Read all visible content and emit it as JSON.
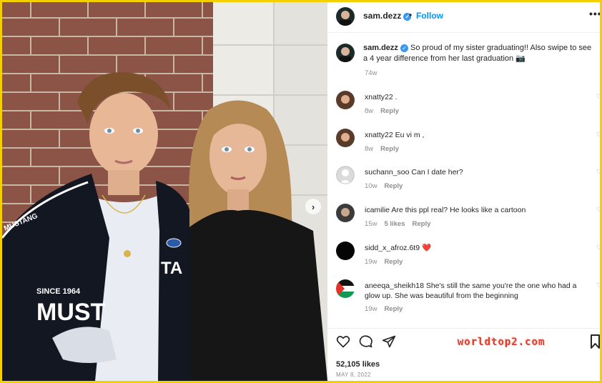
{
  "post": {
    "username": "sam.dezz",
    "dot": "•",
    "follow_label": "Follow",
    "more_label": "•••",
    "verified_glyph": "✓",
    "next_glyph": "›"
  },
  "caption": {
    "username": "sam.dezz",
    "text": "So proud of my sister graduating!! Also swipe to see a 4 year difference from her last graduation 📷",
    "time": "74w"
  },
  "comments": [
    {
      "username": "xnatty22",
      "text": ".",
      "time": "8w",
      "likes": "",
      "reply": "Reply"
    },
    {
      "username": "xnatty22",
      "text": "Eu vi m ,",
      "time": "8w",
      "likes": "",
      "reply": "Reply"
    },
    {
      "username": "suchann_soo",
      "text": "Can I date her?",
      "time": "10w",
      "likes": "",
      "reply": "Reply"
    },
    {
      "username": "icamilie",
      "text": "Are this ppl real? He looks like a cartoon",
      "time": "15w",
      "likes": "5 likes",
      "reply": "Reply"
    },
    {
      "username": "sidd_x_afroz.6t9",
      "text": "❤️",
      "time": "19w",
      "likes": "",
      "reply": "Reply"
    },
    {
      "username": "aneeqa_sheikh18",
      "text": "She's still the same you're the one who had a glow up. She was beautiful from the beginning",
      "time": "19w",
      "likes": "",
      "reply": "Reply"
    }
  ],
  "footer": {
    "likes": "52,105 likes",
    "date": "MAY 8, 2022",
    "watermark": "worldtop2.com"
  },
  "icons": [
    "heart-icon",
    "comment-icon",
    "share-icon",
    "bookmark-icon",
    "more-options-icon",
    "verified-icon",
    "chevron-right-icon"
  ],
  "colors": {
    "accent": "#0095f6",
    "verified": "#3897f0",
    "border": "#f5d000",
    "heart": "#ed4956"
  },
  "photo": {
    "jacket_text_1": "SINCE 1964",
    "jacket_text_2": "MUST",
    "jacket_text_3": "MUSTANG",
    "jacket_text_4": "TA"
  }
}
